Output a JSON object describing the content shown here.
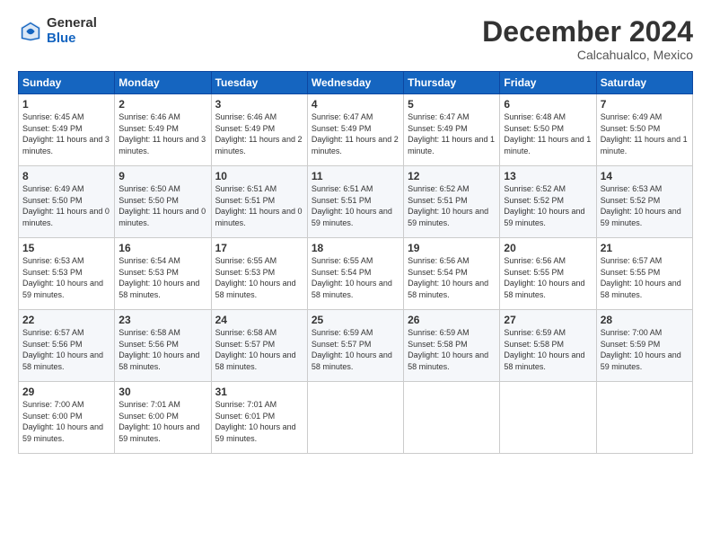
{
  "logo": {
    "general": "General",
    "blue": "Blue"
  },
  "header": {
    "month": "December 2024",
    "location": "Calcahualco, Mexico"
  },
  "weekdays": [
    "Sunday",
    "Monday",
    "Tuesday",
    "Wednesday",
    "Thursday",
    "Friday",
    "Saturday"
  ],
  "weeks": [
    [
      {
        "day": "1",
        "sunrise": "6:45 AM",
        "sunset": "5:49 PM",
        "daylight": "11 hours and 3 minutes."
      },
      {
        "day": "2",
        "sunrise": "6:46 AM",
        "sunset": "5:49 PM",
        "daylight": "11 hours and 3 minutes."
      },
      {
        "day": "3",
        "sunrise": "6:46 AM",
        "sunset": "5:49 PM",
        "daylight": "11 hours and 2 minutes."
      },
      {
        "day": "4",
        "sunrise": "6:47 AM",
        "sunset": "5:49 PM",
        "daylight": "11 hours and 2 minutes."
      },
      {
        "day": "5",
        "sunrise": "6:47 AM",
        "sunset": "5:49 PM",
        "daylight": "11 hours and 1 minute."
      },
      {
        "day": "6",
        "sunrise": "6:48 AM",
        "sunset": "5:50 PM",
        "daylight": "11 hours and 1 minute."
      },
      {
        "day": "7",
        "sunrise": "6:49 AM",
        "sunset": "5:50 PM",
        "daylight": "11 hours and 1 minute."
      }
    ],
    [
      {
        "day": "8",
        "sunrise": "6:49 AM",
        "sunset": "5:50 PM",
        "daylight": "11 hours and 0 minutes."
      },
      {
        "day": "9",
        "sunrise": "6:50 AM",
        "sunset": "5:50 PM",
        "daylight": "11 hours and 0 minutes."
      },
      {
        "day": "10",
        "sunrise": "6:51 AM",
        "sunset": "5:51 PM",
        "daylight": "11 hours and 0 minutes."
      },
      {
        "day": "11",
        "sunrise": "6:51 AM",
        "sunset": "5:51 PM",
        "daylight": "10 hours and 59 minutes."
      },
      {
        "day": "12",
        "sunrise": "6:52 AM",
        "sunset": "5:51 PM",
        "daylight": "10 hours and 59 minutes."
      },
      {
        "day": "13",
        "sunrise": "6:52 AM",
        "sunset": "5:52 PM",
        "daylight": "10 hours and 59 minutes."
      },
      {
        "day": "14",
        "sunrise": "6:53 AM",
        "sunset": "5:52 PM",
        "daylight": "10 hours and 59 minutes."
      }
    ],
    [
      {
        "day": "15",
        "sunrise": "6:53 AM",
        "sunset": "5:53 PM",
        "daylight": "10 hours and 59 minutes."
      },
      {
        "day": "16",
        "sunrise": "6:54 AM",
        "sunset": "5:53 PM",
        "daylight": "10 hours and 58 minutes."
      },
      {
        "day": "17",
        "sunrise": "6:55 AM",
        "sunset": "5:53 PM",
        "daylight": "10 hours and 58 minutes."
      },
      {
        "day": "18",
        "sunrise": "6:55 AM",
        "sunset": "5:54 PM",
        "daylight": "10 hours and 58 minutes."
      },
      {
        "day": "19",
        "sunrise": "6:56 AM",
        "sunset": "5:54 PM",
        "daylight": "10 hours and 58 minutes."
      },
      {
        "day": "20",
        "sunrise": "6:56 AM",
        "sunset": "5:55 PM",
        "daylight": "10 hours and 58 minutes."
      },
      {
        "day": "21",
        "sunrise": "6:57 AM",
        "sunset": "5:55 PM",
        "daylight": "10 hours and 58 minutes."
      }
    ],
    [
      {
        "day": "22",
        "sunrise": "6:57 AM",
        "sunset": "5:56 PM",
        "daylight": "10 hours and 58 minutes."
      },
      {
        "day": "23",
        "sunrise": "6:58 AM",
        "sunset": "5:56 PM",
        "daylight": "10 hours and 58 minutes."
      },
      {
        "day": "24",
        "sunrise": "6:58 AM",
        "sunset": "5:57 PM",
        "daylight": "10 hours and 58 minutes."
      },
      {
        "day": "25",
        "sunrise": "6:59 AM",
        "sunset": "5:57 PM",
        "daylight": "10 hours and 58 minutes."
      },
      {
        "day": "26",
        "sunrise": "6:59 AM",
        "sunset": "5:58 PM",
        "daylight": "10 hours and 58 minutes."
      },
      {
        "day": "27",
        "sunrise": "6:59 AM",
        "sunset": "5:58 PM",
        "daylight": "10 hours and 58 minutes."
      },
      {
        "day": "28",
        "sunrise": "7:00 AM",
        "sunset": "5:59 PM",
        "daylight": "10 hours and 59 minutes."
      }
    ],
    [
      {
        "day": "29",
        "sunrise": "7:00 AM",
        "sunset": "6:00 PM",
        "daylight": "10 hours and 59 minutes."
      },
      {
        "day": "30",
        "sunrise": "7:01 AM",
        "sunset": "6:00 PM",
        "daylight": "10 hours and 59 minutes."
      },
      {
        "day": "31",
        "sunrise": "7:01 AM",
        "sunset": "6:01 PM",
        "daylight": "10 hours and 59 minutes."
      },
      null,
      null,
      null,
      null
    ]
  ]
}
